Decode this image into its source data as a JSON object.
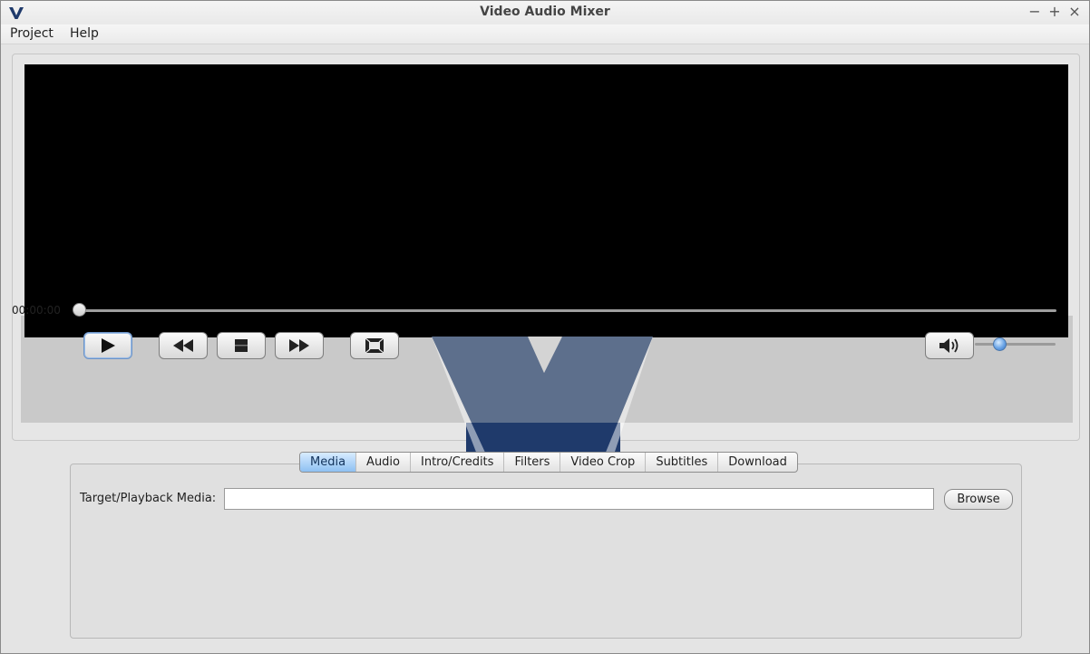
{
  "window": {
    "title": "Video Audio Mixer",
    "controls": {
      "minimize": "−",
      "maximize": "+",
      "close": "×"
    }
  },
  "menu": {
    "items": [
      "Project",
      "Help"
    ]
  },
  "player": {
    "time": "00:00:00",
    "seek_fraction": 0.0,
    "volume_fraction": 0.3,
    "buttons": [
      "play",
      "rewind",
      "stop",
      "fast-forward",
      "fullscreen",
      "volume"
    ]
  },
  "tabs": {
    "items": [
      "Media",
      "Audio",
      "Intro/Credits",
      "Filters",
      "Video Crop",
      "Subtitles",
      "Download"
    ],
    "selected": "Media"
  },
  "media_tab": {
    "target_label": "Target/Playback Media:",
    "target_value": "",
    "browse_label": "Browse"
  },
  "colors": {
    "accent": "#8ec0f2",
    "watermark": "#1f3a6b",
    "video_bg": "#000000"
  }
}
